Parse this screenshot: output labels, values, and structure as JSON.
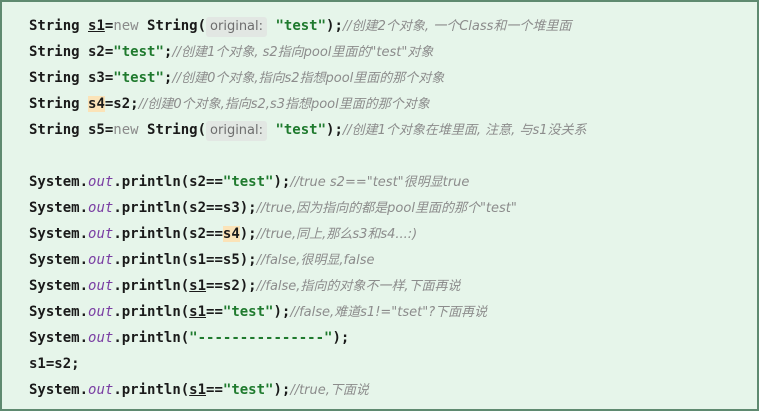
{
  "editor": {
    "lines": [
      {
        "parts": [
          {
            "t": "String ",
            "c": ""
          },
          {
            "t": "s1",
            "c": "ul"
          },
          {
            "t": "=",
            "c": ""
          },
          {
            "t": "new",
            "c": "kw"
          },
          {
            "t": " String(",
            "c": ""
          },
          {
            "t": "original:",
            "c": "hint"
          },
          {
            "t": " ",
            "c": ""
          },
          {
            "t": "\"test\"",
            "c": "str"
          },
          {
            "t": ");",
            "c": ""
          },
          {
            "t": "//创建2个对象, 一个Class和一个堆里面",
            "c": "cmt"
          }
        ]
      },
      {
        "parts": [
          {
            "t": "String s2=",
            "c": ""
          },
          {
            "t": "\"test\"",
            "c": "str"
          },
          {
            "t": ";",
            "c": ""
          },
          {
            "t": "//创建1个对象, s2指向pool里面的\"test\"对象",
            "c": "cmt"
          }
        ]
      },
      {
        "parts": [
          {
            "t": "String s3=",
            "c": ""
          },
          {
            "t": "\"test\"",
            "c": "str"
          },
          {
            "t": ";",
            "c": ""
          },
          {
            "t": "//创建0个对象,指向s2指想pool里面的那个对象",
            "c": "cmt"
          }
        ]
      },
      {
        "parts": [
          {
            "t": "String ",
            "c": ""
          },
          {
            "t": "s4",
            "c": "hl"
          },
          {
            "t": "=s2;",
            "c": ""
          },
          {
            "t": "//创建0个对象,指向s2,s3指想pool里面的那个对象",
            "c": "cmt"
          }
        ]
      },
      {
        "parts": [
          {
            "t": "String s5=",
            "c": ""
          },
          {
            "t": "new",
            "c": "kw"
          },
          {
            "t": " String(",
            "c": ""
          },
          {
            "t": "original:",
            "c": "hint"
          },
          {
            "t": " ",
            "c": ""
          },
          {
            "t": "\"test\"",
            "c": "str"
          },
          {
            "t": ");",
            "c": ""
          },
          {
            "t": "//创建1个对象在堆里面, 注意, 与s1没关系",
            "c": "cmt"
          }
        ]
      },
      {
        "blank": true,
        "parts": []
      },
      {
        "parts": [
          {
            "t": "System.",
            "c": ""
          },
          {
            "t": "out",
            "c": "field"
          },
          {
            "t": ".println(s2==",
            "c": ""
          },
          {
            "t": "\"test\"",
            "c": "str"
          },
          {
            "t": ");",
            "c": ""
          },
          {
            "t": "//true s2==\"test\"很明显true",
            "c": "cmt"
          }
        ]
      },
      {
        "parts": [
          {
            "t": "System.",
            "c": ""
          },
          {
            "t": "out",
            "c": "field"
          },
          {
            "t": ".println(s2==s3);",
            "c": ""
          },
          {
            "t": "//true,因为指向的都是pool里面的那个\"test\"",
            "c": "cmt"
          }
        ]
      },
      {
        "parts": [
          {
            "t": "System.",
            "c": ""
          },
          {
            "t": "out",
            "c": "field"
          },
          {
            "t": ".println(s2==",
            "c": ""
          },
          {
            "t": "s4",
            "c": "hl"
          },
          {
            "t": ");",
            "c": ""
          },
          {
            "t": "//true,同上,那么s3和s4...:)",
            "c": "cmt"
          }
        ]
      },
      {
        "parts": [
          {
            "t": "System.",
            "c": ""
          },
          {
            "t": "out",
            "c": "field"
          },
          {
            "t": ".println(s1==s5);",
            "c": ""
          },
          {
            "t": "//false,很明显,false",
            "c": "cmt"
          }
        ]
      },
      {
        "parts": [
          {
            "t": "System.",
            "c": ""
          },
          {
            "t": "out",
            "c": "field"
          },
          {
            "t": ".println(",
            "c": ""
          },
          {
            "t": "s1",
            "c": "ul"
          },
          {
            "t": "==s2);",
            "c": ""
          },
          {
            "t": "//false,指向的对象不一样,下面再说",
            "c": "cmt"
          }
        ]
      },
      {
        "parts": [
          {
            "t": "System.",
            "c": ""
          },
          {
            "t": "out",
            "c": "field"
          },
          {
            "t": ".println(",
            "c": ""
          },
          {
            "t": "s1",
            "c": "ul"
          },
          {
            "t": "==",
            "c": ""
          },
          {
            "t": "\"test\"",
            "c": "str"
          },
          {
            "t": ");",
            "c": ""
          },
          {
            "t": "//false,难道s1!=\"tset\"?下面再说",
            "c": "cmt"
          }
        ]
      },
      {
        "parts": [
          {
            "t": "System.",
            "c": ""
          },
          {
            "t": "out",
            "c": "field"
          },
          {
            "t": ".println(",
            "c": ""
          },
          {
            "t": "\"---------------\"",
            "c": "str"
          },
          {
            "t": ");",
            "c": ""
          }
        ]
      },
      {
        "parts": [
          {
            "t": "s1=s2;",
            "c": ""
          }
        ]
      },
      {
        "parts": [
          {
            "t": "System.",
            "c": ""
          },
          {
            "t": "out",
            "c": "field"
          },
          {
            "t": ".println(",
            "c": ""
          },
          {
            "t": "s1",
            "c": "ul"
          },
          {
            "t": "==",
            "c": ""
          },
          {
            "t": "\"test\"",
            "c": "str"
          },
          {
            "t": ");",
            "c": ""
          },
          {
            "t": "//true,下面说",
            "c": "cmt"
          }
        ]
      }
    ]
  }
}
